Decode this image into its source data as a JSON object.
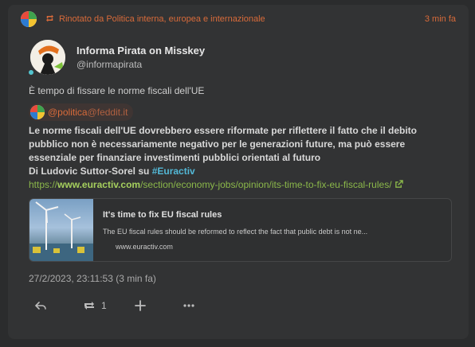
{
  "renote": {
    "label": "Rinotato da Politica interna, europea e internazionale",
    "time": "3 min fa"
  },
  "author": {
    "display_name": "Informa Pirata on Misskey",
    "username": "@informapirata"
  },
  "post": {
    "title": "È tempo di fissare le norme fiscali dell'UE",
    "mention_user": "@politica",
    "mention_host": "@feddit.it",
    "text_line1": "Le norme fiscali dell'UE dovrebbero essere riformate per riflettere il fatto che il debito",
    "text_line2": "pubblico non è necessariamente negativo per le generazioni future, ma può essere",
    "text_line3": "essenziale per finanziare investimenti pubblici orientati al futuro",
    "byline": "Di Ludovic Suttor-Sorel su ",
    "hashtag": "#Euractiv",
    "url_scheme": "https://",
    "url_host": "www.euractiv.com",
    "url_path": "/section/economy-jobs/opinion/its-time-to-fix-eu-fiscal-rules/"
  },
  "preview": {
    "title": "It's time to fix EU fiscal rules",
    "description": "The EU fiscal rules should be reformed to reflect the fact that public debt is not ne...",
    "site": "www.euractiv.com"
  },
  "timestamp": "27/2/2023, 23:11:53 (3 min fa)",
  "actions": {
    "renote_count": "1"
  },
  "icons": [
    "renote-icon",
    "reply-icon",
    "renote-action-icon",
    "plus-icon",
    "more-icon",
    "external-link-icon"
  ],
  "colors": {
    "accent": "#d96b3a",
    "hashtag": "#53b8d6",
    "link": "#8bb84a",
    "online": "#53c5d0"
  }
}
